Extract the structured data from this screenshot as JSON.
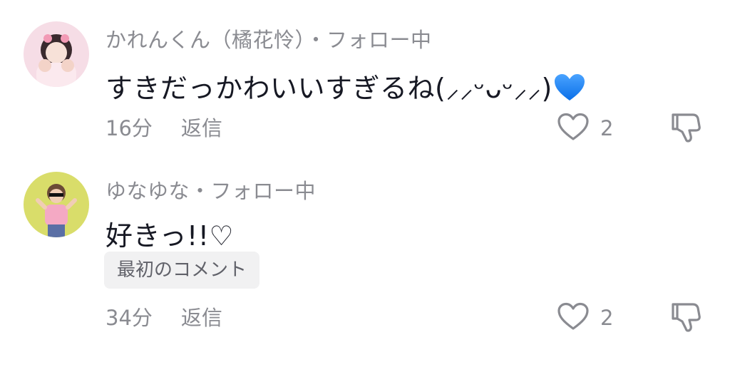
{
  "comments": [
    {
      "username": "かれんくん（橘花怜）",
      "follow_status": "・フォロー中",
      "text": "すきだっかわいいすぎるね(⸝⸝ᵕᴗᵕ⸝⸝)",
      "emoji": "blue-heart-icon",
      "badge": "",
      "time": "16分",
      "reply_label": "返信",
      "like_count": "2"
    },
    {
      "username": "ゆなゆな",
      "follow_status": "・フォロー中",
      "text": "好きっ!!♡",
      "badge": "最初のコメント",
      "time": "34分",
      "reply_label": "返信",
      "like_count": "2"
    }
  ],
  "colors": {
    "secondary_text": "#8a8b91",
    "primary_text": "#161823",
    "badge_bg": "#f1f1f2",
    "icon_stroke": "#8a8b91",
    "heart_blue": "#1e88ff"
  }
}
